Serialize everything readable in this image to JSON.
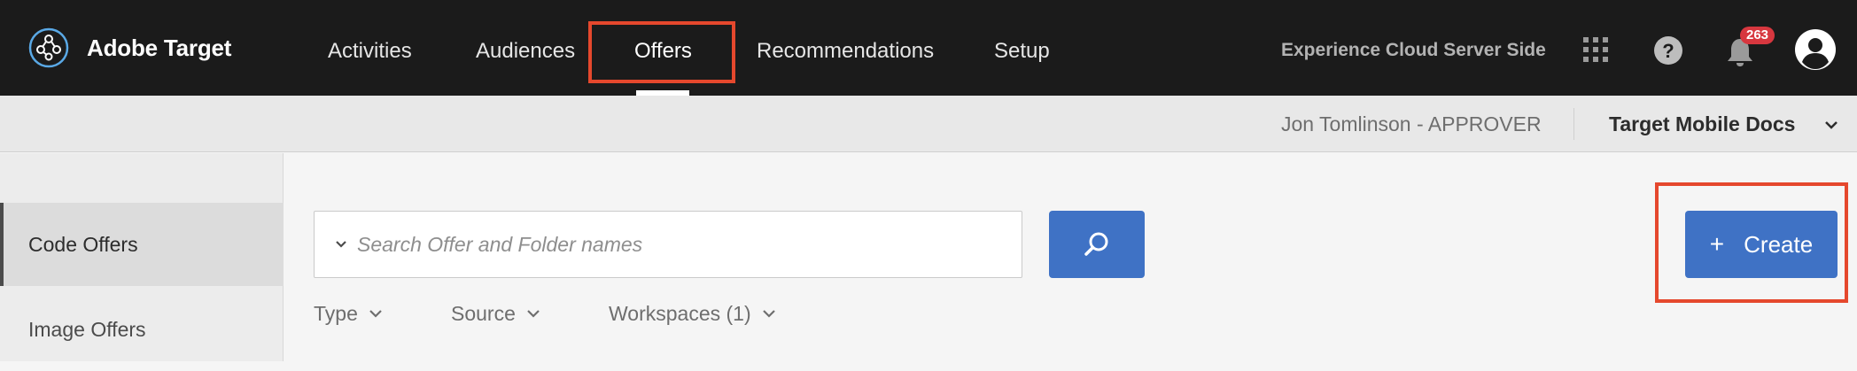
{
  "header": {
    "app_title": "Adobe Target",
    "nav": [
      "Activities",
      "Audiences",
      "Offers",
      "Recommendations",
      "Setup"
    ],
    "active_nav": "Offers",
    "org_name": "Experience Cloud Server Side",
    "notification_count": "263",
    "icons": [
      "apps-grid-icon",
      "help-icon",
      "bell-icon",
      "user-avatar-icon"
    ]
  },
  "subheader": {
    "user": "Jon Tomlinson - APPROVER",
    "workspace": "Target Mobile Docs"
  },
  "sidebar": {
    "items": [
      "Code Offers",
      "Image Offers"
    ],
    "active": "Code Offers"
  },
  "search": {
    "placeholder": "Search Offer and Folder names"
  },
  "filters": [
    "Type",
    "Source",
    "Workspaces (1)"
  ],
  "actions": {
    "create_label": "Create",
    "create_icon": "+"
  },
  "colors": {
    "topbar": "#1b1b1b",
    "accent_blue": "#3f72c5",
    "highlight_red": "#e5482d",
    "badge_red": "#d7373f"
  }
}
